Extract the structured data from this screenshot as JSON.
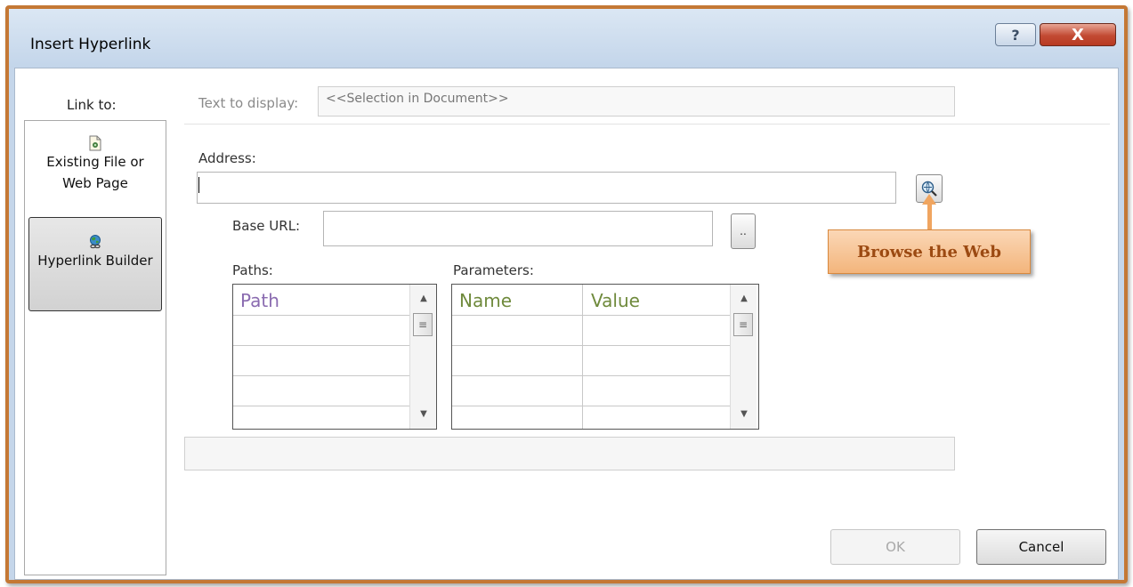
{
  "window": {
    "title": "Insert Hyperlink",
    "help_glyph": "?",
    "close_glyph": "X"
  },
  "link_to": {
    "label": "Link to:",
    "items": [
      {
        "label_line1": "Existing File or",
        "label_line2": "Web Page",
        "icon": "existing-file-icon",
        "selected": false
      },
      {
        "label_line1": "Hyperlink Builder",
        "label_line2": "",
        "icon": "globe-link-icon",
        "selected": true
      }
    ]
  },
  "text_to_display": {
    "label": "Text to display:",
    "value": "<<Selection in Document>>"
  },
  "address": {
    "label": "Address:",
    "value": ""
  },
  "base_url": {
    "label": "Base URL:",
    "value": "",
    "button_label": ".."
  },
  "paths": {
    "label": "Paths:",
    "column": "Path"
  },
  "parameters": {
    "label": "Parameters:",
    "columns": [
      "Name",
      "Value"
    ]
  },
  "buttons": {
    "ok": "OK",
    "cancel": "Cancel"
  },
  "callout": {
    "text": "Browse the Web"
  },
  "colors": {
    "path_header": "#8a6bb0",
    "param_header": "#6f8a3c",
    "callout_fill": "#f3b57c",
    "callout_text": "#9c4a12",
    "frame_border": "#c47835"
  }
}
